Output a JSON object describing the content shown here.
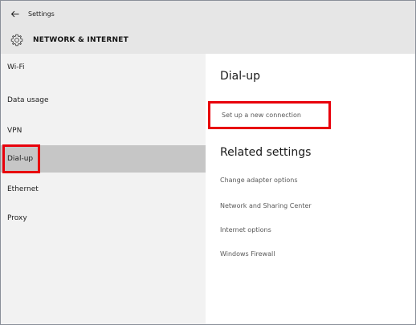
{
  "window": {
    "back_icon": "arrow-left-icon",
    "title": "Settings"
  },
  "header": {
    "icon": "gear-icon",
    "title": "NETWORK & INTERNET"
  },
  "sidebar": {
    "items": [
      {
        "label": "Wi-Fi",
        "selected": false
      },
      {
        "label": "Data usage",
        "selected": false
      },
      {
        "label": "VPN",
        "selected": false
      },
      {
        "label": "Dial-up",
        "selected": true
      },
      {
        "label": "Ethernet",
        "selected": false
      },
      {
        "label": "Proxy",
        "selected": false
      }
    ]
  },
  "main": {
    "title": "Dial-up",
    "new_connection": "Set up a new connection",
    "related_heading": "Related settings",
    "related_links": [
      "Change adapter options",
      "Network and Sharing Center",
      "Internet options",
      "Windows Firewall"
    ]
  },
  "colors": {
    "highlight_border": "#e8000b",
    "selected_bg": "#c6c6c6",
    "sidebar_bg": "#f2f2f2",
    "titlebar_bg": "#e6e6e6",
    "link_text": "#595959"
  }
}
